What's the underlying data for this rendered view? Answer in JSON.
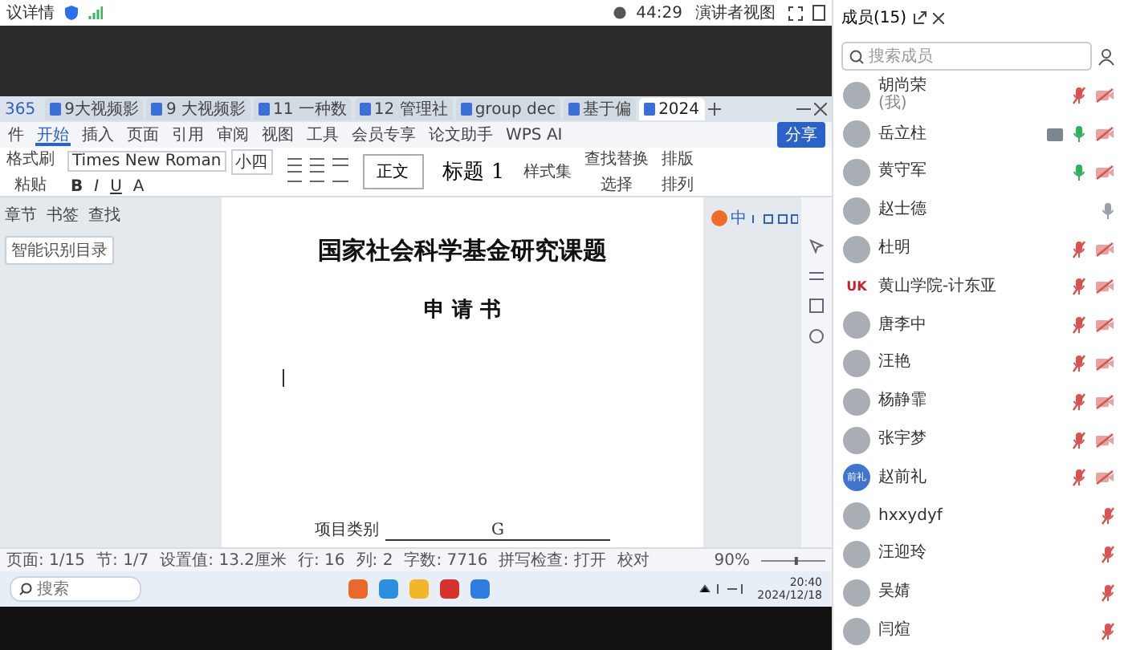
{
  "meeting_bar": {
    "title": "议详情",
    "timer": "44:29",
    "view_button": "演讲者视图"
  },
  "wps": {
    "brand": "365",
    "tabs": [
      {
        "label": "9大视频影",
        "selected": false
      },
      {
        "label": "9 大视频影",
        "selected": false
      },
      {
        "label": "11 一种数",
        "selected": false
      },
      {
        "label": "12 管理社",
        "selected": false
      },
      {
        "label": "group dec",
        "selected": false
      },
      {
        "label": "基于偏",
        "selected": false
      },
      {
        "label": "2024",
        "selected": true
      }
    ],
    "file_menu": "件",
    "ribbon_tabs": [
      {
        "label": "开始",
        "selected": true
      },
      {
        "label": "插入",
        "selected": false
      },
      {
        "label": "页面",
        "selected": false
      },
      {
        "label": "引用",
        "selected": false
      },
      {
        "label": "审阅",
        "selected": false
      },
      {
        "label": "视图",
        "selected": false
      },
      {
        "label": "工具",
        "selected": false
      },
      {
        "label": "会员专享",
        "selected": false
      },
      {
        "label": "论文助手",
        "selected": false
      }
    ],
    "ai_button": "WPS AI",
    "share_button": "分享",
    "ribbon": {
      "format_painter": "格式刷",
      "paste": "粘贴",
      "font": "Times New Roman",
      "size": "小四",
      "format_buttons": [
        "B",
        "I",
        "U",
        "A"
      ],
      "styles": [
        "正文",
        "标题 1"
      ],
      "style_set": "样式集",
      "find": "查找替换",
      "select": "选择",
      "layout": "排版",
      "arrange": "排列"
    },
    "nav_pane": {
      "tabs": [
        "章节",
        "书签",
        "查找"
      ],
      "smart_toc": "智能识别目录"
    },
    "ime_bar": {
      "label": "中"
    },
    "document": {
      "title": "国家社会科学基金研究课题",
      "subtitle": "申 请 书",
      "field_label": "项目类别",
      "field_value": "G"
    },
    "status_bar": {
      "items": [
        "页面: 1/15",
        "节: 1/7",
        "设置值: 13.2厘米",
        "行: 16",
        "列: 2",
        "字数: 7716",
        "拼写检查: 打开",
        "校对"
      ],
      "zoom": "90%",
      "zoom_slider": {
        "level": 0.55
      }
    },
    "taskbar": {
      "search_placeholder": "搜索",
      "time": "20:40",
      "date": "2024/12/18"
    }
  },
  "members_panel": {
    "title": "成员(15)",
    "search": {
      "placeholder": "搜索成员"
    },
    "members": [
      {
        "name": "胡尚荣",
        "note": "(我)",
        "avatar": {
          "kind": "photo"
        },
        "mic_muted": true,
        "speaking": false,
        "camera_off": true,
        "sharing": false
      },
      {
        "name": "岳立柱",
        "avatar": {
          "kind": "photo"
        },
        "mic_muted": false,
        "speaking": true,
        "camera_off": true,
        "sharing": true
      },
      {
        "name": "黄守军",
        "avatar": {
          "kind": "photo"
        },
        "mic_muted": false,
        "speaking": true,
        "camera_off": true,
        "sharing": false
      },
      {
        "name": "赵士德",
        "avatar": {
          "kind": "photo"
        },
        "mic_muted": false,
        "speaking": false,
        "camera_off": false,
        "sharing": false
      },
      {
        "name": "杜明",
        "avatar": {
          "kind": "photo"
        },
        "mic_muted": true,
        "speaking": false,
        "camera_off": true,
        "sharing": false
      },
      {
        "name": "黄山学院-计东亚",
        "avatar": {
          "kind": "logo",
          "label": "UK",
          "color": "#c8202a"
        },
        "mic_muted": true,
        "speaking": false,
        "camera_off": true,
        "sharing": false
      },
      {
        "name": "唐李中",
        "avatar": {
          "kind": "photo"
        },
        "mic_muted": true,
        "speaking": false,
        "camera_off": true,
        "sharing": false
      },
      {
        "name": "汪艳",
        "avatar": {
          "kind": "photo"
        },
        "mic_muted": true,
        "speaking": false,
        "camera_off": true,
        "sharing": false
      },
      {
        "name": "杨静霏",
        "avatar": {
          "kind": "photo"
        },
        "mic_muted": true,
        "speaking": false,
        "camera_off": true,
        "sharing": false
      },
      {
        "name": "张宇梦",
        "avatar": {
          "kind": "photo"
        },
        "mic_muted": true,
        "speaking": false,
        "camera_off": true,
        "sharing": false
      },
      {
        "name": "赵前礼",
        "avatar": {
          "kind": "text",
          "label": "前礼",
          "color": "#3f74cf"
        },
        "mic_muted": true,
        "speaking": false,
        "camera_off": true,
        "sharing": false
      },
      {
        "name": "hxxydyf",
        "avatar": {
          "kind": "photo"
        },
        "mic_muted": true,
        "speaking": false,
        "camera_off": false,
        "sharing": false
      },
      {
        "name": "汪迎玲",
        "avatar": {
          "kind": "photo"
        },
        "mic_muted": true,
        "speaking": false,
        "camera_off": false,
        "sharing": false
      },
      {
        "name": "吴婧",
        "avatar": {
          "kind": "photo"
        },
        "mic_muted": true,
        "speaking": false,
        "camera_off": false,
        "sharing": false
      },
      {
        "name": "闫煊",
        "avatar": {
          "kind": "photo"
        },
        "mic_muted": true,
        "speaking": false,
        "camera_off": false,
        "sharing": false
      }
    ]
  }
}
